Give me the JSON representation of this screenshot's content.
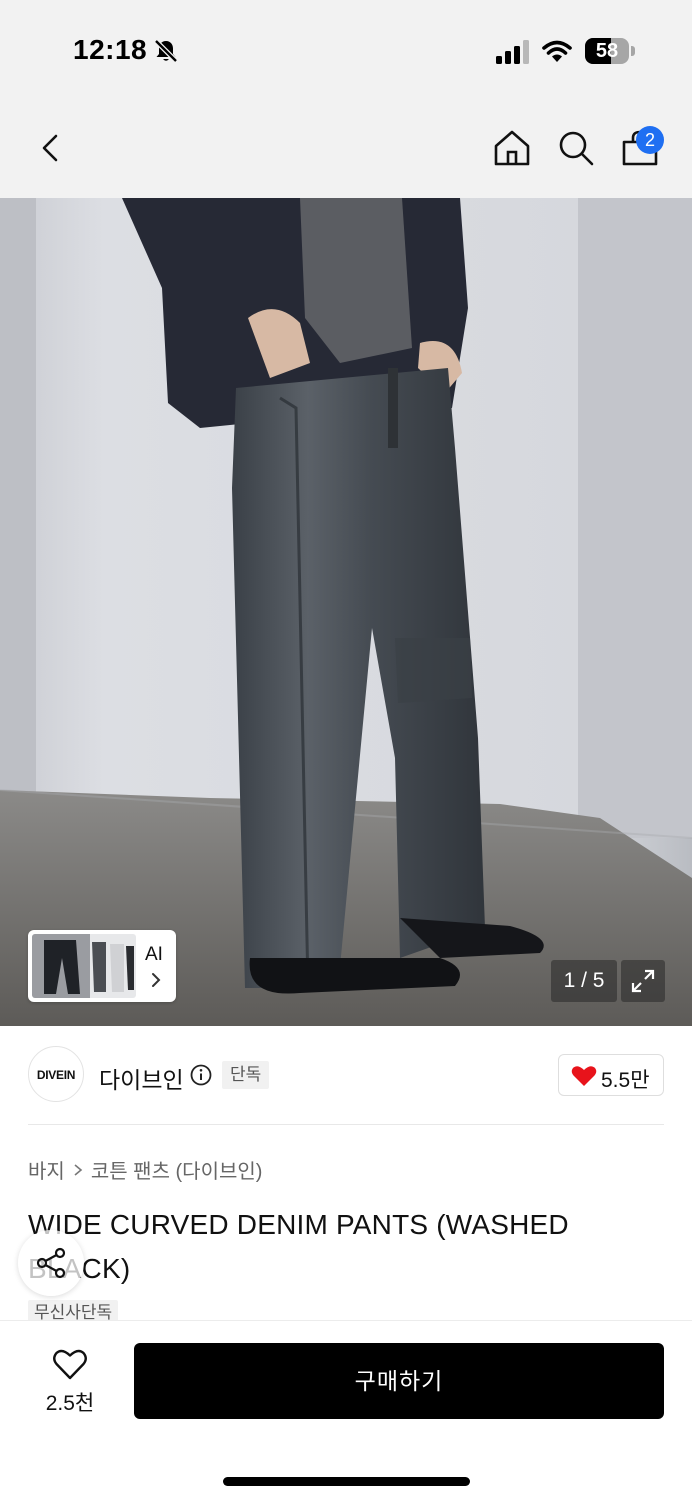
{
  "status_bar": {
    "time": "12:18",
    "battery_level": "58",
    "battery_fraction": 0.58,
    "icons": [
      "bell-slash-icon",
      "cellular-signal-icon",
      "wifi-icon",
      "battery-icon"
    ]
  },
  "header": {
    "icons": [
      "back-icon",
      "home-icon",
      "search-icon",
      "shopping-bag-icon"
    ],
    "cart_count": "2",
    "accent_color": "#1f6ff2"
  },
  "gallery": {
    "page_counter": "1 / 5",
    "ai_label": "AI",
    "ai_icons": [
      "chevron-right-icon"
    ],
    "expand_icon": "expand-icon"
  },
  "brand": {
    "logo_text": "DIVEIN",
    "name": "다이브인",
    "exclusive_badge": "단독",
    "like_count": "5.5만",
    "heart_color": "#e8131b"
  },
  "product": {
    "breadcrumb": [
      "바지",
      "코튼 팬츠 (다이브인)"
    ],
    "title": "WIDE CURVED DENIM PANTS (WASHED BLACK)",
    "store_badge": "무신사단독"
  },
  "bottom_bar": {
    "wish_count": "2.5천",
    "buy_label": "구매하기"
  }
}
